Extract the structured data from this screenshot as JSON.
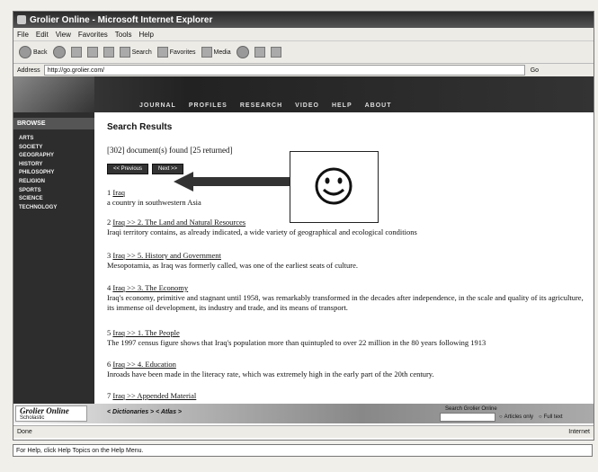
{
  "window": {
    "title": "Grolier Online - Microsoft Internet Explorer"
  },
  "menu": [
    "File",
    "Edit",
    "View",
    "Favorites",
    "Tools",
    "Help"
  ],
  "toolbar": {
    "back": "Back",
    "search": "Search",
    "favorites": "Favorites",
    "media": "Media"
  },
  "address": {
    "label": "Address",
    "url": "http://go.grolier.com/",
    "go": "Go"
  },
  "site_nav": [
    "JOURNAL",
    "PROFILES",
    "RESEARCH",
    "VIDEO",
    "HELP",
    "ABOUT"
  ],
  "sidebar": {
    "browse": "BROWSE",
    "items": [
      "ARTS",
      "SOCIETY",
      "GEOGRAPHY",
      "HISTORY",
      "PHILOSOPHY",
      "RELIGION",
      "SPORTS",
      "SCIENCE",
      "TECHNOLOGY"
    ]
  },
  "main": {
    "title": "Search Results",
    "found": "[302] document(s) found [25 returned]",
    "buttons": [
      "<< Previous",
      "Next >>"
    ],
    "results": [
      {
        "num": "1",
        "link": "Iraq",
        "desc": "a country in southwestern Asia"
      },
      {
        "num": "2",
        "link": "Iraq >> 2. The Land and Natural Resources",
        "desc": "Iraqi territory contains, as already indicated, a wide variety of geographical and ecological conditions"
      },
      {
        "num": "3",
        "link": "Iraq >> 5. History and Government",
        "desc": "Mesopotamia, as Iraq was formerly called, was one of the earliest seats of culture."
      },
      {
        "num": "4",
        "link": "Iraq >> 3. The Economy",
        "desc": "Iraq's economy, primitive and stagnant until 1958, was remarkably transformed in the decades after independence, in the scale and quality of its agriculture, its immense oil development, its industry and trade, and its means of transport."
      },
      {
        "num": "5",
        "link": "Iraq >> 1. The People",
        "desc": "The 1997 census figure shows that Iraq's population more than quintupled to over 22 million in the 80 years following 1913"
      },
      {
        "num": "6",
        "link": "Iraq >> 4. Education",
        "desc": "Inroads have been made in the literacy rate, which was extremely high in the early part of the 20th century."
      },
      {
        "num": "7",
        "link": "Iraq >> Appended Material",
        "desc": ""
      }
    ]
  },
  "bottom": {
    "brand": "Grolier Online",
    "brand_sub": "Scholastic",
    "tabs": "< Dictionaries >  < Atlas >",
    "search_label": "Search Grolier Online",
    "radio1": "Articles only",
    "radio2": "Full text"
  },
  "status": {
    "left": "Done",
    "right": "Internet"
  },
  "helpbar": "For Help, click Help Topics on the Help Menu."
}
